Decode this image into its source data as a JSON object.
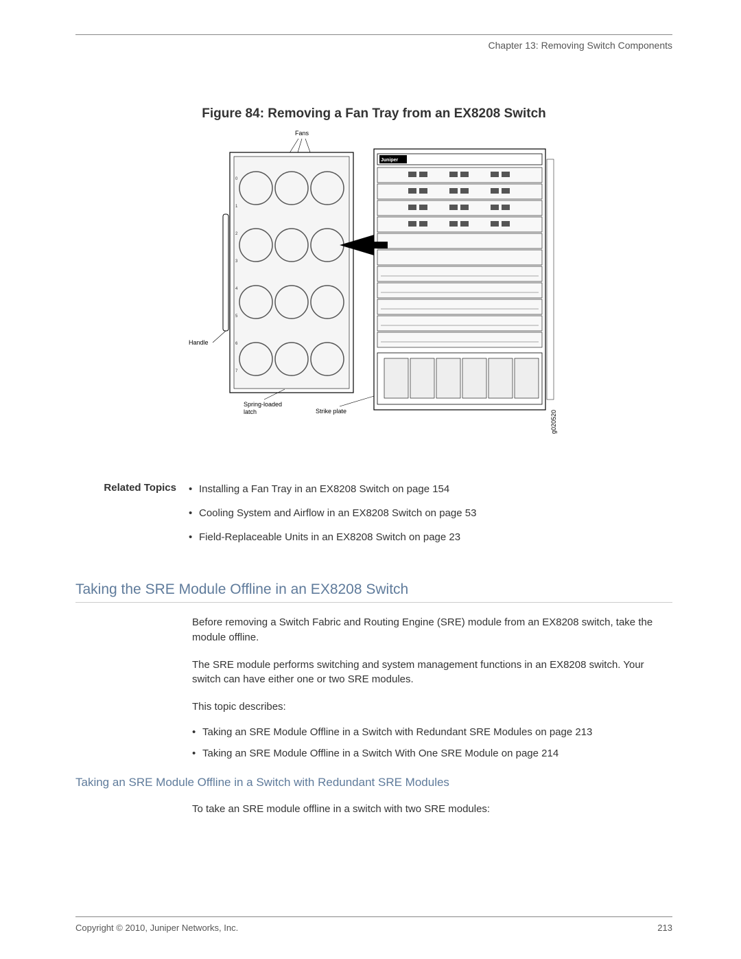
{
  "header": {
    "chapter": "Chapter 13:  Removing Switch Components"
  },
  "figure": {
    "title": "Figure 84: Removing a Fan Tray from an EX8208 Switch",
    "callouts": {
      "fans": "Fans",
      "handle": "Handle",
      "spring_latch": "Spring-loaded\nlatch",
      "strike_plate": "Strike plate",
      "brand": "Juniper",
      "figure_id": "g020520"
    }
  },
  "related": {
    "label": "Related Topics",
    "items": [
      "Installing a Fan Tray in an EX8208 Switch on page 154",
      "Cooling System and Airflow in an EX8208 Switch on page 53",
      "Field-Replaceable Units in an EX8208 Switch on page 23"
    ]
  },
  "section": {
    "heading": "Taking the SRE Module Offline in an EX8208 Switch",
    "p1": "Before removing a Switch Fabric and Routing Engine (SRE) module from an EX8208 switch, take the module offline.",
    "p2": "The SRE module performs switching and system management functions in an EX8208 switch. Your switch can have either one or two SRE modules.",
    "p3": "This topic describes:",
    "toc": [
      "Taking an SRE Module Offline in a Switch with Redundant SRE Modules on page 213",
      "Taking an SRE Module Offline in a Switch With One SRE Module on page 214"
    ],
    "subheading": "Taking an SRE Module Offline in a Switch with Redundant SRE Modules",
    "p4": "To take an SRE module offline in a switch with two SRE modules:"
  },
  "footer": {
    "copyright": "Copyright © 2010, Juniper Networks, Inc.",
    "page": "213"
  }
}
